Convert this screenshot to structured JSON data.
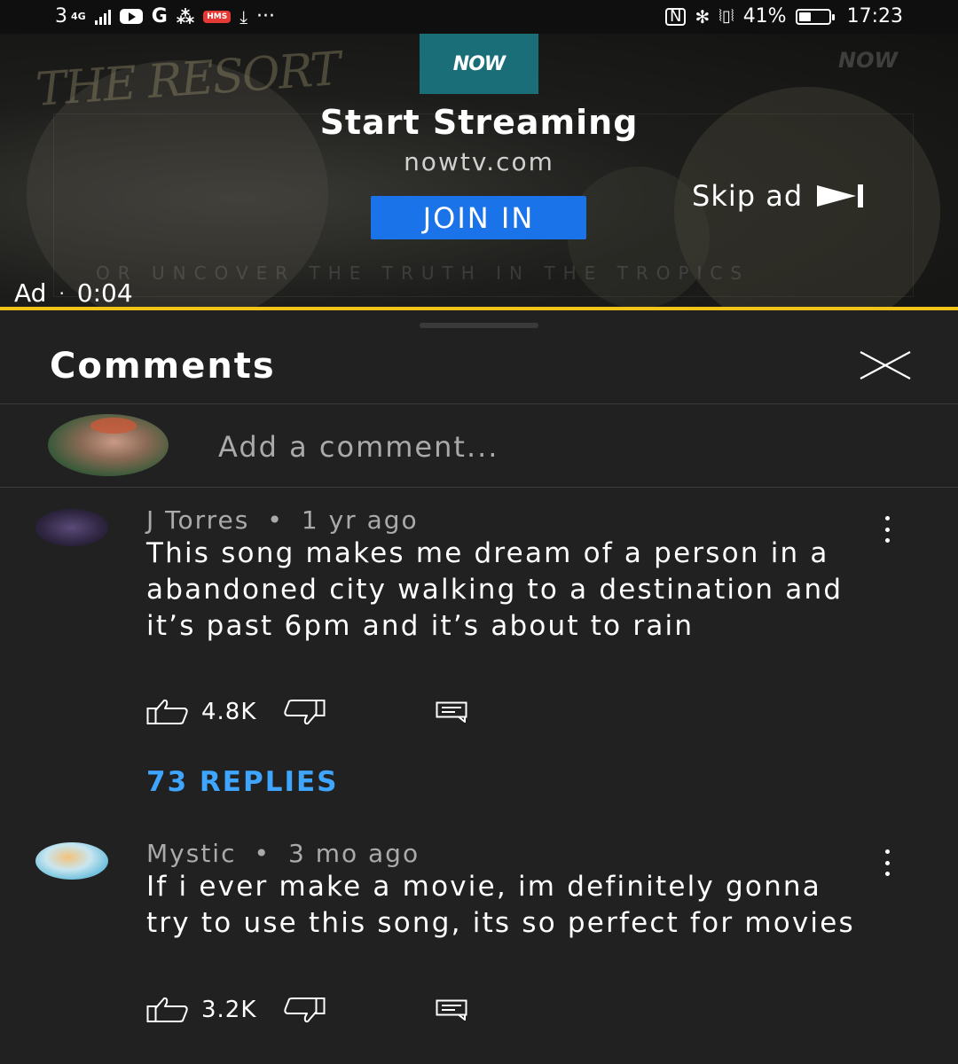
{
  "status_bar": {
    "carrier_num": "3",
    "network": "4G",
    "battery_percent": "41%",
    "battery_level": 0.41,
    "time": "17:23",
    "more": "···"
  },
  "ad": {
    "show_logo": "THE RESORT",
    "brand": "NOW",
    "title": "Start Streaming",
    "url": "nowtv.com",
    "cta": "JOIN IN",
    "skip_label": "Skip ad",
    "tagline": "OR UNCOVER THE TRUTH IN THE TROPICS",
    "ad_label": "Ad",
    "separator": "·",
    "time": "0:04",
    "progress_color": "#f2c418",
    "cta_color": "#1a73e8"
  },
  "comments_panel": {
    "title": "Comments",
    "add_placeholder": "Add a comment...",
    "comments": [
      {
        "author": "J Torres",
        "time": "1 yr ago",
        "text": "This song makes me dream of a person in a abandoned city walking to a destination and it’s past 6pm and it’s about to rain",
        "likes": "4.8K",
        "replies": "73 REPLIES"
      },
      {
        "author": "Mystic",
        "time": "3 mo ago",
        "text": "If i ever make a movie, im definitely gonna try to use this song, its so perfect for movies",
        "likes": "3.2K"
      }
    ]
  },
  "colors": {
    "background": "#212121",
    "reply_link": "#3ea6ff",
    "secondary_text": "#aaaaaa"
  }
}
